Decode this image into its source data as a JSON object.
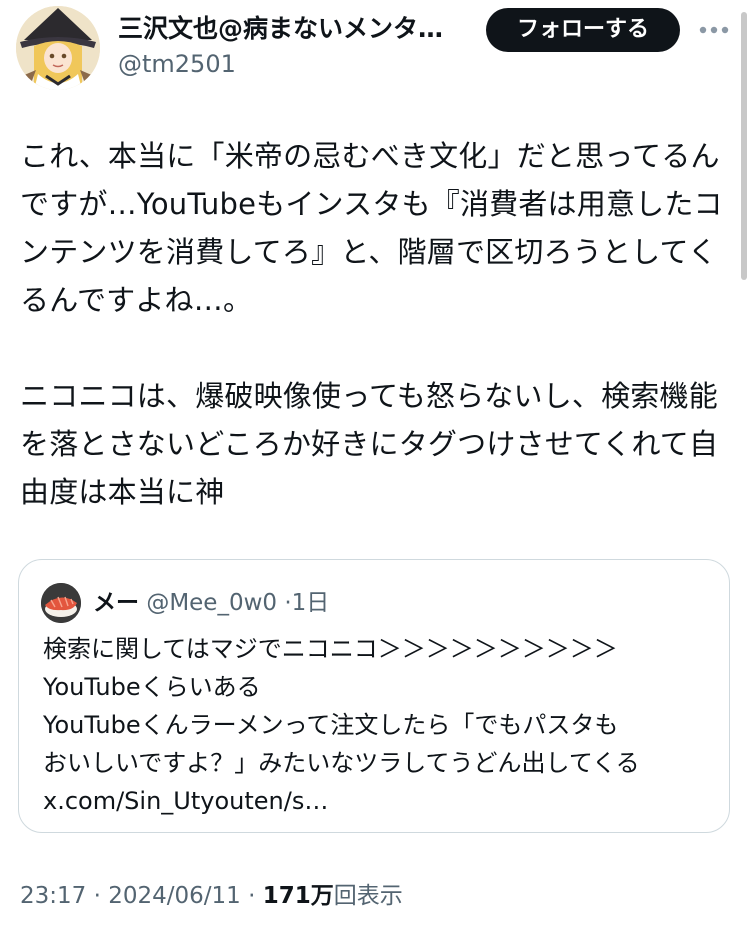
{
  "author": {
    "display_name": "三沢文也@病まないメンタ…",
    "handle": "@tm2501",
    "avatar_icon": "anime-character-avatar"
  },
  "follow_button": {
    "label": "フォローする"
  },
  "more_button": {
    "icon": "more-horizontal-icon"
  },
  "tweet": {
    "paragraphs": [
      "これ、本当に「米帝の忌むべき文化」だと思ってるんですが…YouTubeもインスタも『消費者は用意したコンテンツを消費してろ』と、階層で区切ろうとしてくるんですよね…。",
      "ニコニコは、爆破映像使っても怒らないし、検索機能を落とさないどころか好きにタグつけさせてくれて自由度は本当に神"
    ]
  },
  "quote": {
    "avatar_icon": "sushi-avatar",
    "display_name": "メー",
    "handle": "@Mee_0w0",
    "separator": "·",
    "time": "1日",
    "lines": [
      "検索に関してはマジでニコニコ＞＞＞＞＞＞＞＞＞＞",
      "YouTubeくらいある",
      "YouTubeくんラーメンって注文したら「でもパスタも",
      "おいしいですよ？」みたいなツラしてうどん出してくる",
      "x.com/Sin_Utyouten/s…"
    ]
  },
  "meta": {
    "time": "23:17",
    "separator": "·",
    "date": "2024/06/11",
    "views_count": "171万",
    "views_label": "回表示"
  },
  "colors": {
    "text_primary": "#0f1419",
    "text_secondary": "#536471",
    "border": "#cfd9de",
    "button_bg": "#0f1419",
    "button_text": "#ffffff"
  }
}
